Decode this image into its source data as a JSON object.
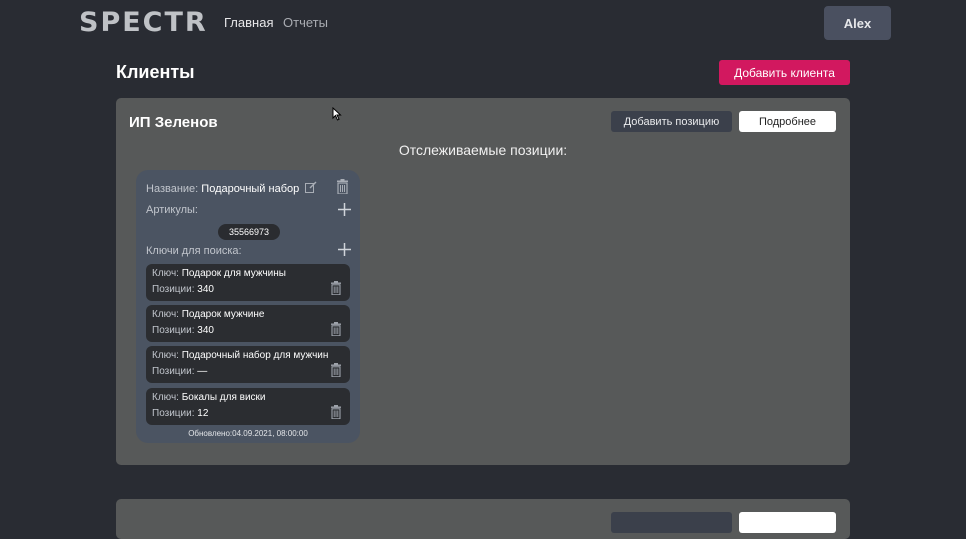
{
  "nav": {
    "logo": "SPECTR",
    "home": "Главная",
    "reports": "Отчеты",
    "user": "Alex"
  },
  "page": {
    "title": "Клиенты",
    "add_client": "Добавить клиента"
  },
  "client": {
    "name": "ИП Зеленов",
    "add_position": "Добавить позицию",
    "details": "Подробнее",
    "tracked_title": "Отслеживаемые позиции:",
    "position": {
      "name_label": "Название:",
      "name": "Подарочный набор",
      "articles_label": "Артикулы:",
      "article": "35566973",
      "keys_label": "Ключи для поиска:",
      "key_label": "Ключ:",
      "pos_label": "Позиции:",
      "keys": [
        {
          "key": "Подарок для мужчины",
          "positions": "340"
        },
        {
          "key": "Подарок мужчине",
          "positions": "340"
        },
        {
          "key": "Подарочный набор для мужчин",
          "positions": "—"
        },
        {
          "key": "Бокалы для виски",
          "positions": "12"
        }
      ],
      "updated": "Обновлено:04.09.2021, 08:00:00"
    }
  },
  "icons": {
    "edit": "edit-icon",
    "trash": "trash-icon",
    "plus": "plus-icon",
    "cursor": "cursor-icon"
  },
  "colors": {
    "background": "#292c33",
    "accent": "#d2185f",
    "card": "#575959",
    "position_card": "#4b5462"
  }
}
